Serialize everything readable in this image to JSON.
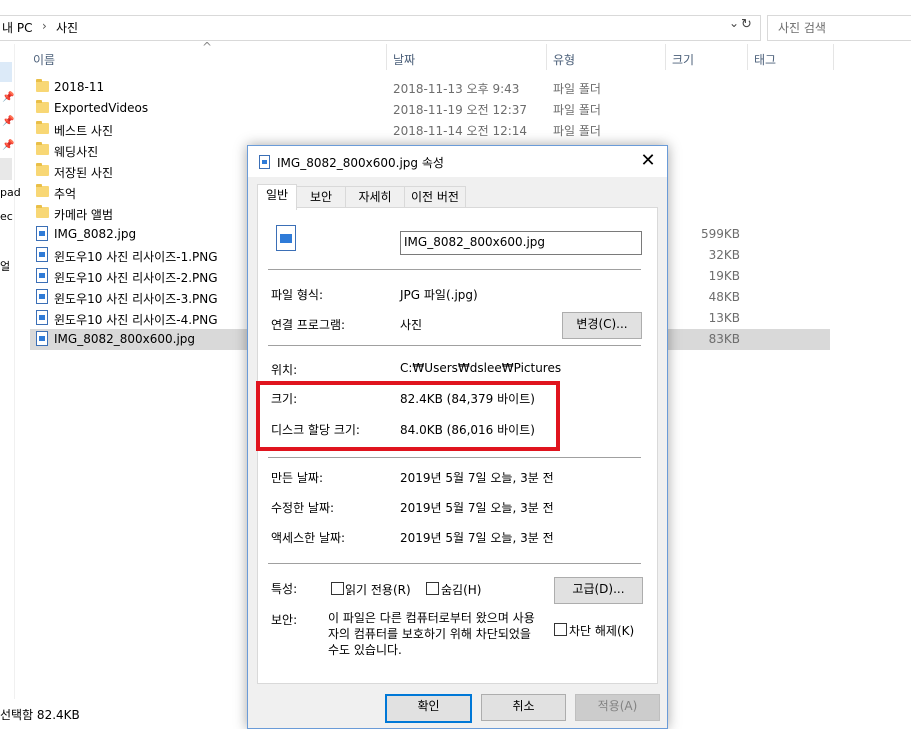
{
  "address": {
    "crumbs": [
      "내 PC",
      "사진"
    ],
    "separator": "›",
    "dropdown_glyph": "⌄",
    "refresh_glyph": "↻",
    "search_placeholder": "사진 검색"
  },
  "columns": {
    "name": "이름",
    "date": "날짜",
    "type": "유형",
    "size": "크기",
    "tags": "태그",
    "sort_glyph": "^"
  },
  "nav_fragments": [
    "pad",
    "ec",
    "얼"
  ],
  "files": [
    {
      "name": "2018-11",
      "date": "2018-11-13 오후 9:43",
      "type": "파일 폴더",
      "size": "",
      "kind": "folder"
    },
    {
      "name": "ExportedVideos",
      "date": "2018-11-19 오전 12:37",
      "type": "파일 폴더",
      "size": "",
      "kind": "folder"
    },
    {
      "name": "베스트 사진",
      "date": "2018-11-14 오전 12:14",
      "type": "파일 폴더",
      "size": "",
      "kind": "folder"
    },
    {
      "name": "웨딩사진",
      "date": "",
      "type": "",
      "size": "",
      "kind": "folder"
    },
    {
      "name": "저장된 사진",
      "date": "",
      "type": "",
      "size": "",
      "kind": "folder"
    },
    {
      "name": "추억",
      "date": "",
      "type": "",
      "size": "",
      "kind": "folder"
    },
    {
      "name": "카메라 앨범",
      "date": "",
      "type": "",
      "size": "",
      "kind": "folder"
    },
    {
      "name": "IMG_8082.jpg",
      "date": "",
      "type": "",
      "size": "599KB",
      "kind": "image"
    },
    {
      "name": "윈도우10 사진 리사이즈-1.PNG",
      "date": "",
      "type": "",
      "size": "32KB",
      "kind": "image"
    },
    {
      "name": "윈도우10 사진 리사이즈-2.PNG",
      "date": "",
      "type": "",
      "size": "19KB",
      "kind": "image"
    },
    {
      "name": "윈도우10 사진 리사이즈-3.PNG",
      "date": "",
      "type": "",
      "size": "48KB",
      "kind": "image"
    },
    {
      "name": "윈도우10 사진 리사이즈-4.PNG",
      "date": "",
      "type": "",
      "size": "13KB",
      "kind": "image"
    },
    {
      "name": "IMG_8082_800x600.jpg",
      "date": "",
      "type": "",
      "size": "83KB",
      "kind": "image",
      "selected": true
    }
  ],
  "status": {
    "text": "선택함 82.4KB"
  },
  "dialog": {
    "title": "IMG_8082_800x600.jpg 속성",
    "close_glyph": "✕",
    "tabs": [
      "일반",
      "보안",
      "자세히",
      "이전 버전"
    ],
    "filename": "IMG_8082_800x600.jpg",
    "labels": {
      "file_type": "파일 형식:",
      "opens_with": "연결 프로그램:",
      "location": "위치:",
      "size": "크기:",
      "size_on_disk": "디스크 할당 크기:",
      "created": "만든 날짜:",
      "modified": "수정한 날짜:",
      "accessed": "액세스한 날짜:",
      "attributes": "특성:",
      "security": "보안:"
    },
    "values": {
      "file_type": "JPG 파일(.jpg)",
      "opens_with": "사진",
      "location": "C:₩Users₩dslee₩Pictures",
      "size": "82.4KB (84,379 바이트)",
      "size_on_disk": "84.0KB (86,016 바이트)",
      "created": "2019년 5월 7일 오늘, 3분 전",
      "modified": "2019년 5월 7일 오늘, 3분 전",
      "accessed": "2019년 5월 7일 오늘, 3분 전",
      "security_text": "이 파일은 다른 컴퓨터로부터 왔으며 사용자의 컴퓨터를 보호하기 위해 차단되었을 수도 있습니다."
    },
    "buttons": {
      "change": "변경(C)...",
      "advanced": "고급(D)...",
      "ok": "확인",
      "cancel": "취소",
      "apply": "적용(A)"
    },
    "checkboxes": {
      "readonly": "읽기 전용(R)",
      "hidden": "숨김(H)",
      "unblock": "차단 해제(K)"
    }
  },
  "colors": {
    "highlight": "#e0141e",
    "selected_row": "#d9d9d9",
    "accent": "#0078d7"
  }
}
